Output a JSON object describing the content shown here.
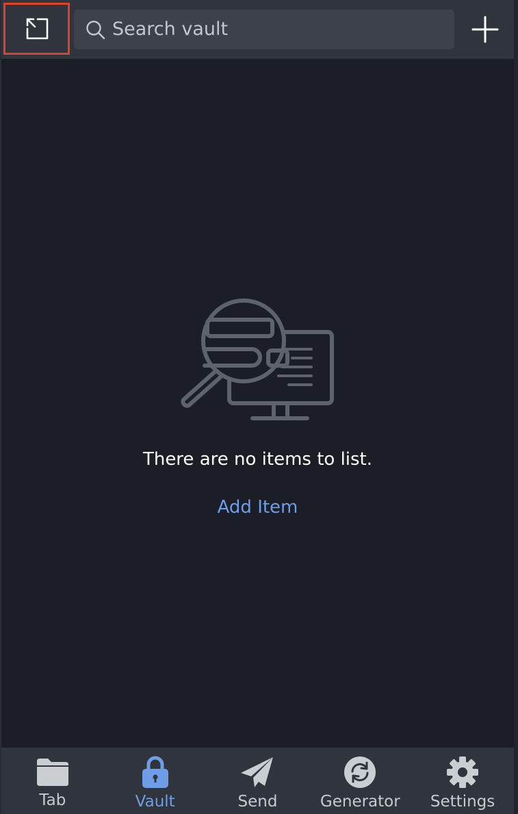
{
  "header": {
    "popout_icon": "popout-icon",
    "search": {
      "placeholder": "Search vault",
      "icon": "search-icon"
    },
    "add_icon": "plus-icon"
  },
  "empty_state": {
    "illustration": "search-monitor-illustration",
    "message": "There are no items to list.",
    "add_item_label": "Add Item"
  },
  "tabs": [
    {
      "label": "Tab",
      "icon": "folder-icon",
      "active": false
    },
    {
      "label": "Vault",
      "icon": "lock-icon",
      "active": true
    },
    {
      "label": "Send",
      "icon": "paper-plane-icon",
      "active": false
    },
    {
      "label": "Generator",
      "icon": "refresh-icon",
      "active": false
    },
    {
      "label": "Settings",
      "icon": "gear-icon",
      "active": false
    }
  ],
  "colors": {
    "background": "#1b1e26",
    "header": "#2f343d",
    "accent": "#6f9de8",
    "highlight_border": "#e0412b"
  }
}
